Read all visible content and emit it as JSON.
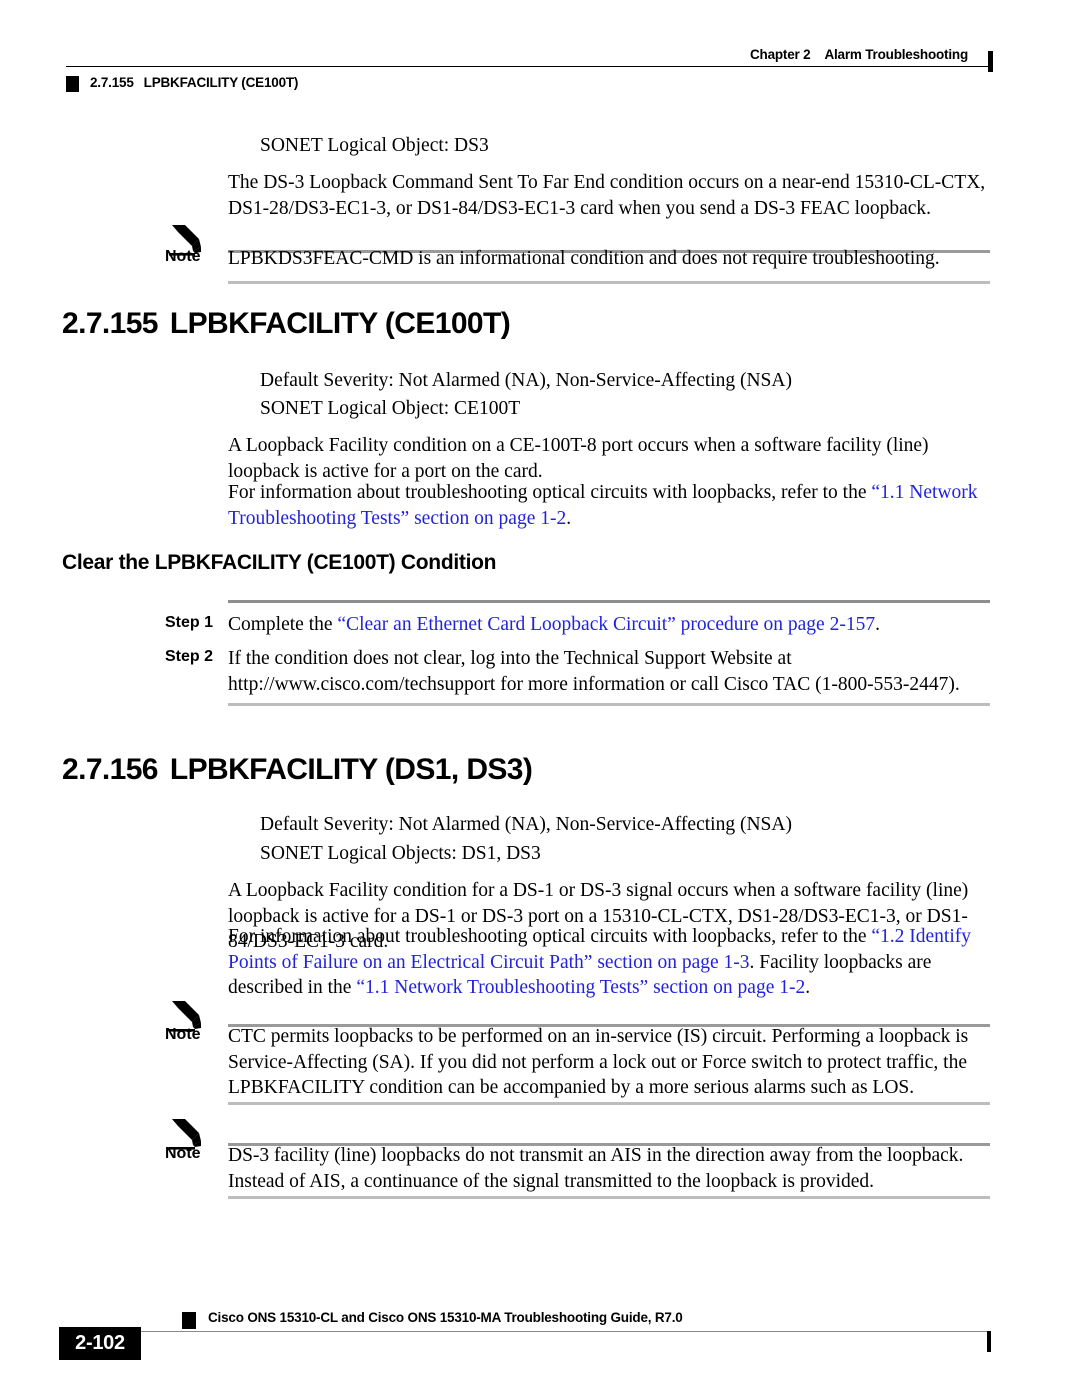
{
  "header": {
    "chapter": "Chapter 2",
    "chapter_title": "Alarm Troubleshooting",
    "section_number": "2.7.155",
    "section_title": "LPBKFACILITY (CE100T)"
  },
  "intro": {
    "logical_object": "SONET Logical Object: DS3",
    "paragraph": "The DS-3 Loopback Command Sent To Far End condition occurs on a near-end 15310-CL-CTX, DS1-28/DS3-EC1-3, or DS1-84/DS3-EC1-3 card when you send a DS-3 FEAC loopback."
  },
  "note_1": {
    "label": "Note",
    "text": "LPBKDS3FEAC-CMD is an informational condition and does not require troubleshooting."
  },
  "section_155": {
    "number": "2.7.155",
    "title": "LPBKFACILITY (CE100T)",
    "default_severity": "Default Severity: Not Alarmed (NA), Non-Service-Affecting (NSA)",
    "logical_object": "SONET Logical Object: CE100T",
    "description": "A Loopback Facility condition on a CE-100T-8 port occurs when a software facility (line) loopback is active for a port on the card.",
    "xref_intro": "For information about troubleshooting optical circuits with loopbacks, refer to the ",
    "xref_link": "“1.1  Network Troubleshooting Tests” section on page 1-2",
    "xref_tail": "."
  },
  "clear_procedure": {
    "heading": "Clear the LPBKFACILITY (CE100T) Condition",
    "steps": [
      {
        "label": "Step 1",
        "text_before": "Complete the ",
        "link": "“Clear an Ethernet Card Loopback Circuit” procedure on page 2-157",
        "text_after": "."
      },
      {
        "label": "Step 2",
        "text_before": "If the condition does not clear, log into the Technical Support Website at http://www.cisco.com/techsupport for more information or call Cisco TAC (1-800-553-2447).",
        "link": "",
        "text_after": ""
      }
    ]
  },
  "section_156": {
    "number": "2.7.156",
    "title": "LPBKFACILITY (DS1, DS3)",
    "default_severity": "Default Severity: Not Alarmed (NA), Non-Service-Affecting (NSA)",
    "logical_object": "SONET Logical Objects: DS1, DS3",
    "description": "A Loopback Facility condition for a DS-1 or DS-3 signal occurs when a software facility (line) loopback is active for a DS-1 or DS-3 port on a 15310-CL-CTX, DS1-28/DS3-EC1-3, or DS1-84/DS3-EC1-3 card.",
    "xref_intro": "For information about troubleshooting optical circuits with loopbacks, refer to the ",
    "xref_link_1": "“1.2  Identify Points of Failure on an Electrical Circuit Path” section on page 1-3",
    "xref_middle": ". Facility loopbacks are described in the ",
    "xref_link_2": "“1.1  Network Troubleshooting Tests” section on page 1-2",
    "xref_tail": "."
  },
  "note_2": {
    "label": "Note",
    "text": "CTC permits loopbacks to be performed on an in-service (IS) circuit. Performing a loopback is Service-Affecting (SA). If you did not perform a lock out or Force switch to protect traffic, the LPBKFACILITY condition can be accompanied by a more serious alarms such as LOS."
  },
  "note_3": {
    "label": "Note",
    "text": "DS-3 facility (line) loopbacks do not transmit an AIS in the direction away from the loopback. Instead of AIS, a continuance of the signal transmitted to the loopback is provided."
  },
  "footer": {
    "guide_title": "Cisco ONS 15310-CL and Cisco ONS 15310-MA Troubleshooting Guide, R7.0",
    "page_number": "2-102"
  },
  "colors": {
    "link": "#2222dd",
    "rule_gray": "#8e8e8e",
    "rule_light": "#bdbdbd",
    "ink": "#000000"
  }
}
